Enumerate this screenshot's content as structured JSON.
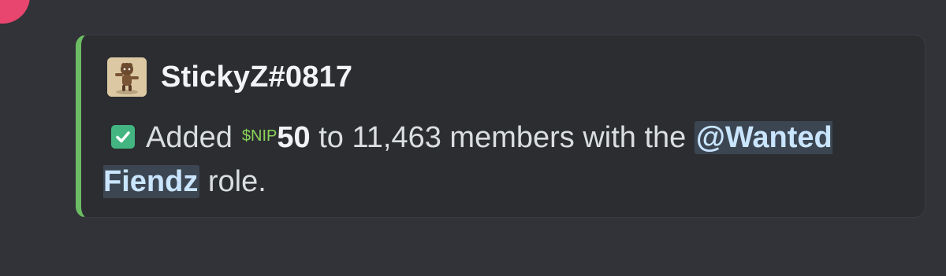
{
  "embed": {
    "accent_color": "#6cbc63",
    "author": {
      "name": "StickyZ#0817",
      "avatar_icon": "cartoon-character-avatar"
    },
    "description": {
      "check_icon": "white-check-mark-icon",
      "text_before": "Added",
      "currency_emoji_text": "$NIP",
      "amount": "50",
      "text_middle": "to 11,463 members with the",
      "role_mention": "@Wanted Fiendz",
      "text_after": "role."
    }
  }
}
